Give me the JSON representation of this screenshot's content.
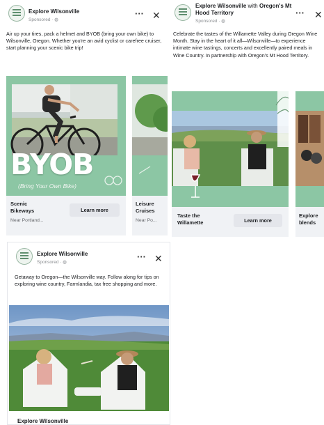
{
  "colors": {
    "brand_green": "#7bb894",
    "overlay_green": "#8dc4a3",
    "button_bg": "#e4e6eb"
  },
  "ads": [
    {
      "page_name": "Explore Wilsonville",
      "sponsored": "Sponsored · ",
      "body": "Air up your tires, pack a helmet and BYOB (bring your own bike) to Wilsonville, Oregon. Whether you're an avid cyclist or carefree cruiser, start planning your scenic bike trip!",
      "carousel": [
        {
          "title": "Scenic Bikeways",
          "subtitle": "Near Portland...",
          "cta": "Learn more",
          "overlay_title": "BYOB",
          "overlay_sub": "(Bring Your Own Bike)"
        },
        {
          "title": "Leisure Cruises",
          "subtitle": "Near Po..."
        }
      ]
    },
    {
      "page_name": "Explore Wilsonville",
      "with_label": "with",
      "partner_name": "Oregon's Mt Hood Territory",
      "sponsored": "Sponsored · ",
      "body": "Celebrate the tastes of the Willamette Valley during Oregon Wine Month. Stay in the heart of it all—Wilsonville—to experience intimate wine tastings, concerts and excellently paired meals in Wine Country. In partnership with Oregon's Mt Hood Territory.",
      "carousel": [
        {
          "title": "Taste the Willamette",
          "cta": "Learn more"
        },
        {
          "title": "Explore blends"
        }
      ]
    },
    {
      "page_name": "Explore Wilsonville",
      "sponsored": "Sponsored · ",
      "body": "Getaway to Oregon—the Wilsonville way. Follow along for tips on exploring wine country, Farmlandia, tax free shopping and more.",
      "footer_page": "Explore Wilsonville"
    }
  ],
  "icons": {
    "more": "more-dots-icon",
    "close": "close-icon",
    "globe": "globe-icon"
  },
  "glyphs": {
    "more": "···",
    "close": "✕"
  }
}
